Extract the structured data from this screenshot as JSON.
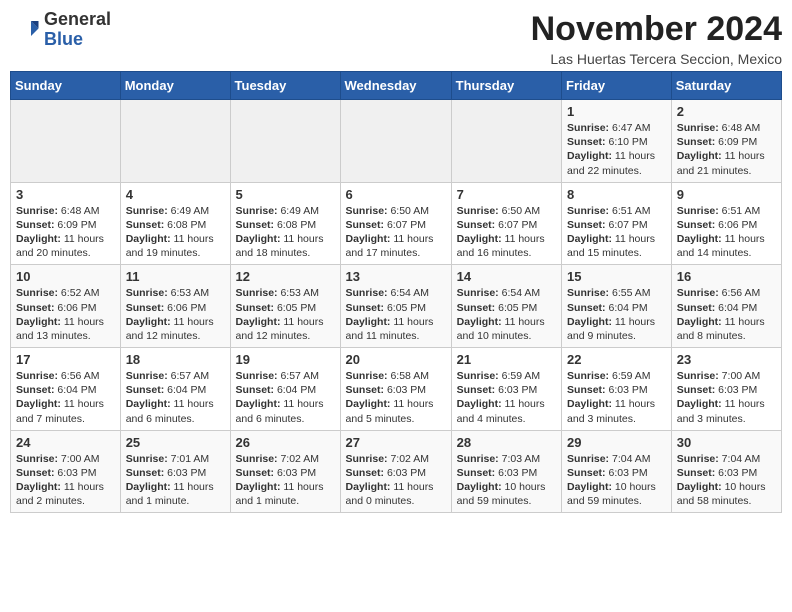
{
  "header": {
    "logo_general": "General",
    "logo_blue": "Blue",
    "month_title": "November 2024",
    "location": "Las Huertas Tercera Seccion, Mexico"
  },
  "weekdays": [
    "Sunday",
    "Monday",
    "Tuesday",
    "Wednesday",
    "Thursday",
    "Friday",
    "Saturday"
  ],
  "weeks": [
    [
      {
        "day": "",
        "info": ""
      },
      {
        "day": "",
        "info": ""
      },
      {
        "day": "",
        "info": ""
      },
      {
        "day": "",
        "info": ""
      },
      {
        "day": "",
        "info": ""
      },
      {
        "day": "1",
        "info": "Sunrise: 6:47 AM\nSunset: 6:10 PM\nDaylight: 11 hours and 22 minutes."
      },
      {
        "day": "2",
        "info": "Sunrise: 6:48 AM\nSunset: 6:09 PM\nDaylight: 11 hours and 21 minutes."
      }
    ],
    [
      {
        "day": "3",
        "info": "Sunrise: 6:48 AM\nSunset: 6:09 PM\nDaylight: 11 hours and 20 minutes."
      },
      {
        "day": "4",
        "info": "Sunrise: 6:49 AM\nSunset: 6:08 PM\nDaylight: 11 hours and 19 minutes."
      },
      {
        "day": "5",
        "info": "Sunrise: 6:49 AM\nSunset: 6:08 PM\nDaylight: 11 hours and 18 minutes."
      },
      {
        "day": "6",
        "info": "Sunrise: 6:50 AM\nSunset: 6:07 PM\nDaylight: 11 hours and 17 minutes."
      },
      {
        "day": "7",
        "info": "Sunrise: 6:50 AM\nSunset: 6:07 PM\nDaylight: 11 hours and 16 minutes."
      },
      {
        "day": "8",
        "info": "Sunrise: 6:51 AM\nSunset: 6:07 PM\nDaylight: 11 hours and 15 minutes."
      },
      {
        "day": "9",
        "info": "Sunrise: 6:51 AM\nSunset: 6:06 PM\nDaylight: 11 hours and 14 minutes."
      }
    ],
    [
      {
        "day": "10",
        "info": "Sunrise: 6:52 AM\nSunset: 6:06 PM\nDaylight: 11 hours and 13 minutes."
      },
      {
        "day": "11",
        "info": "Sunrise: 6:53 AM\nSunset: 6:06 PM\nDaylight: 11 hours and 12 minutes."
      },
      {
        "day": "12",
        "info": "Sunrise: 6:53 AM\nSunset: 6:05 PM\nDaylight: 11 hours and 12 minutes."
      },
      {
        "day": "13",
        "info": "Sunrise: 6:54 AM\nSunset: 6:05 PM\nDaylight: 11 hours and 11 minutes."
      },
      {
        "day": "14",
        "info": "Sunrise: 6:54 AM\nSunset: 6:05 PM\nDaylight: 11 hours and 10 minutes."
      },
      {
        "day": "15",
        "info": "Sunrise: 6:55 AM\nSunset: 6:04 PM\nDaylight: 11 hours and 9 minutes."
      },
      {
        "day": "16",
        "info": "Sunrise: 6:56 AM\nSunset: 6:04 PM\nDaylight: 11 hours and 8 minutes."
      }
    ],
    [
      {
        "day": "17",
        "info": "Sunrise: 6:56 AM\nSunset: 6:04 PM\nDaylight: 11 hours and 7 minutes."
      },
      {
        "day": "18",
        "info": "Sunrise: 6:57 AM\nSunset: 6:04 PM\nDaylight: 11 hours and 6 minutes."
      },
      {
        "day": "19",
        "info": "Sunrise: 6:57 AM\nSunset: 6:04 PM\nDaylight: 11 hours and 6 minutes."
      },
      {
        "day": "20",
        "info": "Sunrise: 6:58 AM\nSunset: 6:03 PM\nDaylight: 11 hours and 5 minutes."
      },
      {
        "day": "21",
        "info": "Sunrise: 6:59 AM\nSunset: 6:03 PM\nDaylight: 11 hours and 4 minutes."
      },
      {
        "day": "22",
        "info": "Sunrise: 6:59 AM\nSunset: 6:03 PM\nDaylight: 11 hours and 3 minutes."
      },
      {
        "day": "23",
        "info": "Sunrise: 7:00 AM\nSunset: 6:03 PM\nDaylight: 11 hours and 3 minutes."
      }
    ],
    [
      {
        "day": "24",
        "info": "Sunrise: 7:00 AM\nSunset: 6:03 PM\nDaylight: 11 hours and 2 minutes."
      },
      {
        "day": "25",
        "info": "Sunrise: 7:01 AM\nSunset: 6:03 PM\nDaylight: 11 hours and 1 minute."
      },
      {
        "day": "26",
        "info": "Sunrise: 7:02 AM\nSunset: 6:03 PM\nDaylight: 11 hours and 1 minute."
      },
      {
        "day": "27",
        "info": "Sunrise: 7:02 AM\nSunset: 6:03 PM\nDaylight: 11 hours and 0 minutes."
      },
      {
        "day": "28",
        "info": "Sunrise: 7:03 AM\nSunset: 6:03 PM\nDaylight: 10 hours and 59 minutes."
      },
      {
        "day": "29",
        "info": "Sunrise: 7:04 AM\nSunset: 6:03 PM\nDaylight: 10 hours and 59 minutes."
      },
      {
        "day": "30",
        "info": "Sunrise: 7:04 AM\nSunset: 6:03 PM\nDaylight: 10 hours and 58 minutes."
      }
    ]
  ]
}
